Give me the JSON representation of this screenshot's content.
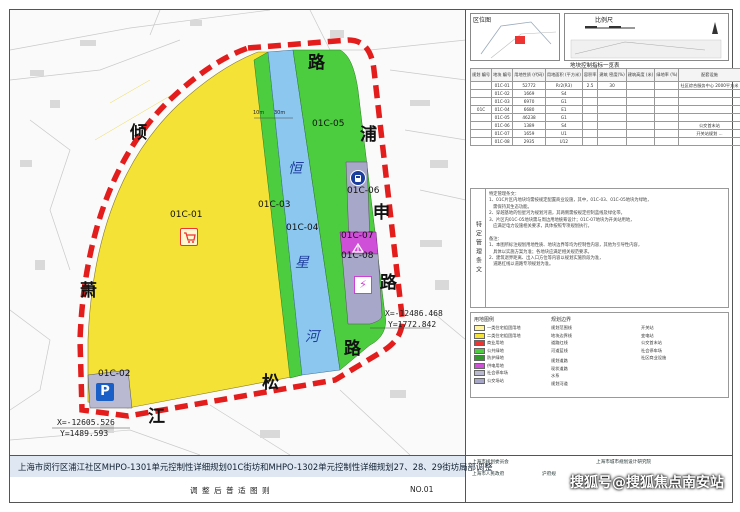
{
  "map": {
    "parcels": {
      "p01": {
        "label": "01C-01",
        "color": "#f4e236"
      },
      "p02": {
        "label": "01C-02",
        "color": "#b9b9d2"
      },
      "p03": {
        "label": "01C-03",
        "color": "#4ccd3f"
      },
      "p04": {
        "label": "01C-04",
        "color": "#8cc7ef"
      },
      "p05": {
        "label": "01C-05",
        "color": "#4ccd3f"
      },
      "p06": {
        "label": "01C-06",
        "color": "#a7a7c9"
      },
      "p07": {
        "label": "01C-07",
        "color": "#cf4fd8"
      },
      "p08": {
        "label": "01C-08",
        "color": "#a7a7c9"
      }
    },
    "roads": {
      "r1": "倾",
      "r2": "路",
      "r3": "浦",
      "r4": "申",
      "r5": "路",
      "r6": "萧",
      "r7": "松",
      "r8": "江"
    },
    "river": {
      "c1": "恒",
      "c2": "星",
      "c3": "河"
    },
    "dims": {
      "d1": "10m",
      "d2": "30m"
    },
    "coords": {
      "east_x": "X=-12486.468",
      "east_y": "Y=1772.842",
      "west_x": "X=-12605.526",
      "west_y": "Y=1489.593"
    },
    "icons": {
      "parking": "P",
      "lightning": "⚡",
      "shop": "cart",
      "bus": "bus",
      "substation": "substation"
    }
  },
  "side": {
    "locator_title": "区位图",
    "scale_title": "比例尺",
    "table_title": "地块控制指标一览表",
    "table_headers": [
      "规划\n编号",
      "地块\n编号",
      "用地性质\n(代码)",
      "用地面积\n(平方米)",
      "容积率",
      "建筑\n密度(%)",
      "建筑高度\n(米)",
      "绿地率\n(%)",
      "配套设施",
      "备注"
    ],
    "table_rows": [
      [
        "",
        "01C-01",
        "52772",
        "Rr2(R3)",
        "2.5",
        "30",
        "",
        "",
        "社区综合服务中心 2000平方米",
        "规划"
      ],
      [
        "",
        "01C-02",
        "1669",
        "S4",
        "",
        "",
        "",
        "",
        "",
        "规划"
      ],
      [
        "",
        "01C-03",
        "6970",
        "G1",
        "",
        "",
        "",
        "",
        "",
        "规划"
      ],
      [
        "01C",
        "01C-04",
        "6680",
        "E1",
        "",
        "",
        "",
        "",
        "",
        "规划"
      ],
      [
        "",
        "01C-05",
        "46238",
        "G1",
        "",
        "",
        "",
        "",
        "",
        "规划"
      ],
      [
        "",
        "01C-06",
        "1389",
        "S4",
        "",
        "",
        "",
        "",
        "公交首末站",
        "规划"
      ],
      [
        "",
        "01C-07",
        "1659",
        "U1",
        "",
        "",
        "",
        "",
        "开关站规划 ...",
        "规划"
      ],
      [
        "",
        "01C-08",
        "2935",
        "U12",
        "",
        "",
        "",
        "",
        "",
        "规划"
      ]
    ],
    "notes_side_title": "特定管理条文",
    "notes_text": "特定管理条文：\n1、01C片区内地块均需按规定配置商业设施，其中，01C-03、01C-05地块为绿地，\n   需保持其生态功能。\n2、穿越基地的恒星河为规划河道，其两侧需按规定控制蓝线及绿化带。\n3、片区内01C-05地块需与周边用地统筹设计；01C-07地块为开关站用地，\n   应满足电力设施相关要求，具体按照专项规划执行。\n\n备注：\n1、本图所标注规划用地性质、地块边界等均为控制性内容，其他为引导性内容，\n   具体以实施方案为准；各地块应满足相关规范要求。\n2、建筑退界距离、出入口方位等内容以规划实施阶段为准，\n   道路红线以道路专项规划为准。",
    "legend_title": "用地图例",
    "legend_items": [
      "一类住宅组团用地",
      "二类住宅组团用地",
      "商业用地",
      "公共绿地",
      "防护绿地",
      "供电用地",
      "社会停车场",
      "公交场站"
    ],
    "legend_col2_title": "规划边界",
    "legend_col2_items": [
      "规划范围线",
      "地块边界线",
      "道路红线",
      "河道蓝线"
    ],
    "legend_col3_items": [
      "规划道路",
      "现状道路",
      "水系",
      "规划河道"
    ],
    "legend_col4_items": [
      "开关站",
      "变电站",
      "公交首末站",
      "社会停车场",
      "社区商业设施"
    ]
  },
  "footer": {
    "title": "上海市闵行区浦江社区MHPO-1301单元控制性详细规划01C街坊和MHPO-1302单元控制性详细规划27、28、29街坊局部调整",
    "subtitle": "调  整  后  普  适  图  则",
    "sheet_no": "NO.01",
    "approver1": "上海市规划委员会",
    "approver2": "上海市城市规划设计研究院",
    "approver3": "上海市人民政府",
    "approver4": "沪府规",
    "watermark": "搜狐号@搜狐焦点南安站"
  }
}
